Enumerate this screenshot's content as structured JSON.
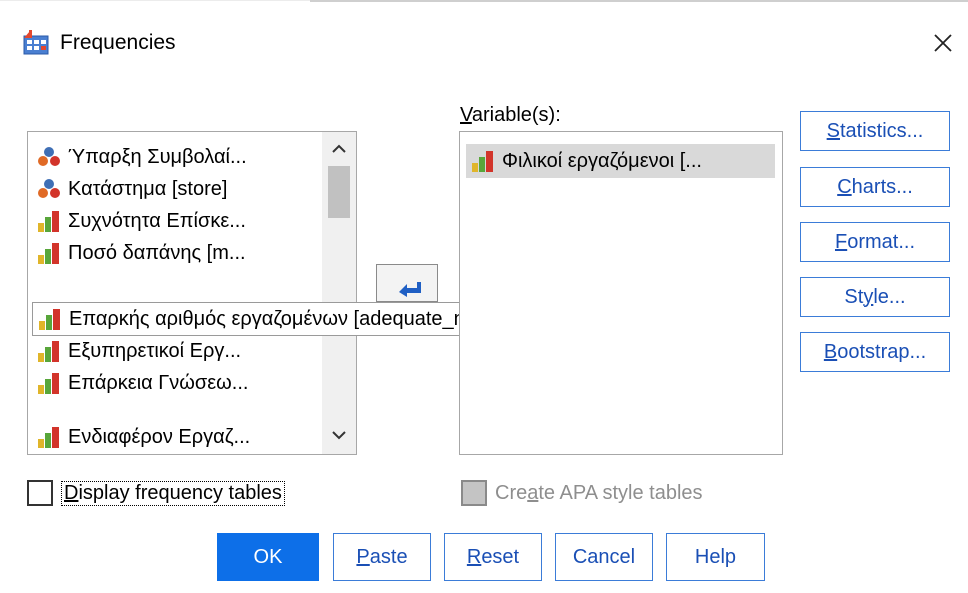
{
  "dialog": {
    "title": "Frequencies",
    "app_icon": "spss-frequencies-icon",
    "close_icon": "close-icon"
  },
  "source_list": {
    "items": [
      {
        "label": "Ύπαρξη Συμβολαί...",
        "icon": "nominal-variable-icon"
      },
      {
        "label": "Κατάστημα [store]",
        "icon": "nominal-variable-icon"
      },
      {
        "label": "Συχνότητα Επίσκε...",
        "icon": "scale-variable-icon"
      },
      {
        "label": "Ποσό δαπάνης [m...",
        "icon": "scale-variable-icon"
      },
      {
        "label": "Επαρκής αριθμός εργαζομένων [adequate_number]",
        "icon": "scale-variable-icon"
      },
      {
        "label": "Εξυπηρετικοί Εργ...",
        "icon": "scale-variable-icon"
      },
      {
        "label": "Επάρκεια Γνώσεω...",
        "icon": "scale-variable-icon"
      },
      {
        "label": "Ενδιαφέρον Εργαζ...",
        "icon": "scale-variable-icon"
      }
    ]
  },
  "target": {
    "label_prefix": "V",
    "label_rest": "ariable(s):",
    "items": [
      {
        "label": "Φιλικοί εργαζόμενοι [...",
        "icon": "scale-variable-icon"
      }
    ]
  },
  "side_buttons": [
    {
      "prefix": "",
      "mnemonic": "S",
      "rest": "tatistics..."
    },
    {
      "prefix": "",
      "mnemonic": "C",
      "rest": "harts..."
    },
    {
      "prefix": "",
      "mnemonic": "F",
      "rest": "ormat..."
    },
    {
      "prefix": "St",
      "mnemonic": "y",
      "rest": "le..."
    },
    {
      "prefix": "",
      "mnemonic": "B",
      "rest": "ootstrap..."
    }
  ],
  "checkboxes": {
    "display_freq": {
      "mnemonic": "D",
      "rest": "isplay frequency tables",
      "checked": false
    },
    "apa": {
      "prefix": "Cre",
      "mnemonic": "a",
      "rest": "te APA style tables",
      "checked": false,
      "disabled": true
    }
  },
  "bottom_buttons": [
    {
      "label": "OK",
      "prefix": "",
      "mnemonic": "",
      "rest": "OK"
    },
    {
      "prefix": "",
      "mnemonic": "P",
      "rest": "aste"
    },
    {
      "prefix": "",
      "mnemonic": "R",
      "rest": "eset"
    },
    {
      "prefix": "",
      "mnemonic": "",
      "rest": "Cancel"
    },
    {
      "prefix": "",
      "mnemonic": "",
      "rest": "Help"
    }
  ],
  "colors": {
    "accent": "#0d6fe8",
    "button_text": "#1a4fb5",
    "selected_bg": "#d9d9d9"
  }
}
